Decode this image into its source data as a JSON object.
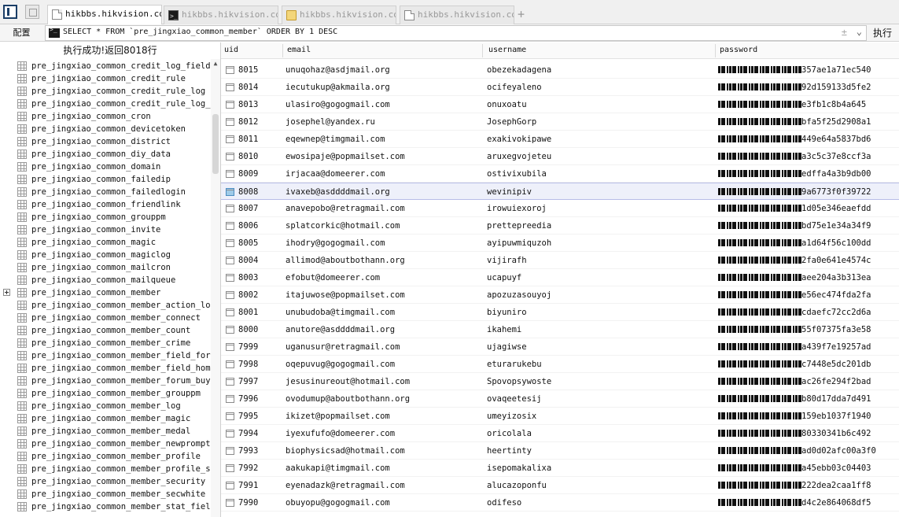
{
  "tabs": [
    {
      "label": "hikbbs.hikvision.com",
      "icon": "document-icon",
      "active": true
    },
    {
      "label": "hikbbs.hikvision.com",
      "icon": "terminal-icon",
      "active": false
    },
    {
      "label": "hikbbs.hikvision.com",
      "icon": "folder-icon",
      "active": false
    },
    {
      "label": "hikbbs.hikvision.com",
      "icon": "document-icon",
      "active": false
    }
  ],
  "toolbar": {
    "config_label": "配置",
    "query": "SELECT * FROM `pre_jingxiao_common_member` ORDER BY 1 DESC",
    "clear_glyph": "±",
    "execute_label": "执行"
  },
  "status": "执行成功!返回8018行",
  "sidebar": {
    "expanded_item": "pre_jingxiao_common_member",
    "tables": [
      "pre_jingxiao_common_credit_log_field",
      "pre_jingxiao_common_credit_rule",
      "pre_jingxiao_common_credit_rule_log",
      "pre_jingxiao_common_credit_rule_log_field",
      "pre_jingxiao_common_cron",
      "pre_jingxiao_common_devicetoken",
      "pre_jingxiao_common_district",
      "pre_jingxiao_common_diy_data",
      "pre_jingxiao_common_domain",
      "pre_jingxiao_common_failedip",
      "pre_jingxiao_common_failedlogin",
      "pre_jingxiao_common_friendlink",
      "pre_jingxiao_common_grouppm",
      "pre_jingxiao_common_invite",
      "pre_jingxiao_common_magic",
      "pre_jingxiao_common_magiclog",
      "pre_jingxiao_common_mailcron",
      "pre_jingxiao_common_mailqueue",
      "pre_jingxiao_common_member",
      "pre_jingxiao_common_member_action_log",
      "pre_jingxiao_common_member_connect",
      "pre_jingxiao_common_member_count",
      "pre_jingxiao_common_member_crime",
      "pre_jingxiao_common_member_field_forum",
      "pre_jingxiao_common_member_field_home",
      "pre_jingxiao_common_member_forum_buylog",
      "pre_jingxiao_common_member_grouppm",
      "pre_jingxiao_common_member_log",
      "pre_jingxiao_common_member_magic",
      "pre_jingxiao_common_member_medal",
      "pre_jingxiao_common_member_newprompt",
      "pre_jingxiao_common_member_profile",
      "pre_jingxiao_common_member_profile_setting",
      "pre_jingxiao_common_member_security",
      "pre_jingxiao_common_member_secwhite",
      "pre_jingxiao_common_member_stat_field"
    ]
  },
  "grid": {
    "columns": [
      "uid",
      "email",
      "username",
      "password"
    ],
    "selected_uid": "8008",
    "rows": [
      {
        "uid": "8015",
        "email": "unuqohaz@asdjmail.org",
        "username": "obezekadagena",
        "password_visible": "357ae1a71ec540"
      },
      {
        "uid": "8014",
        "email": "iecutukup@akmaila.org",
        "username": "ocifeyaleno",
        "password_visible": "92d159133d5fe2"
      },
      {
        "uid": "8013",
        "email": "ulasiro@gogogmail.com",
        "username": "onuxoatu",
        "password_visible": "e3fb1c8b4a645"
      },
      {
        "uid": "8012",
        "email": "josephel@yandex.ru",
        "username": "JosephGorp",
        "password_visible": "bfa5f25d2908a1"
      },
      {
        "uid": "8011",
        "email": "eqewnep@timgmail.com",
        "username": "exakivokipawe",
        "password_visible": "449e64a5837bd6"
      },
      {
        "uid": "8010",
        "email": "ewosipaje@popmailset.com",
        "username": "aruxegvojeteu",
        "password_visible": "a3c5c37e8ccf3a"
      },
      {
        "uid": "8009",
        "email": "irjacaa@domeerer.com",
        "username": "ostivixubila",
        "password_visible": "edffa4a3b9db00"
      },
      {
        "uid": "8008",
        "email": "ivaxeb@asddddmail.org",
        "username": "wevinipiv",
        "password_visible": "9a6773f0f39722"
      },
      {
        "uid": "8007",
        "email": "anavepobo@retragmail.com",
        "username": "irowuiexoroj",
        "password_visible": "1d05e346eaefdd"
      },
      {
        "uid": "8006",
        "email": "splatcorkic@hotmail.com",
        "username": "prettepreedia",
        "password_visible": "bd75e1e34a34f9"
      },
      {
        "uid": "8005",
        "email": "ihodry@gogogmail.com",
        "username": "ayipuwmiquzoh",
        "password_visible": "a1d64f56c100dd"
      },
      {
        "uid": "8004",
        "email": "allimod@aboutbothann.org",
        "username": "vijirafh",
        "password_visible": "2fa0e641e4574c"
      },
      {
        "uid": "8003",
        "email": "efobut@domeerer.com",
        "username": "ucapuyf",
        "password_visible": "aee204a3b313ea"
      },
      {
        "uid": "8002",
        "email": "itajuwose@popmailset.com",
        "username": "apozuzasouyoj",
        "password_visible": "e56ec474fda2fa"
      },
      {
        "uid": "8001",
        "email": "unubudoba@timgmail.com",
        "username": "biyuniro",
        "password_visible": "cdaefc72cc2d6a"
      },
      {
        "uid": "8000",
        "email": "anutore@asddddmail.org",
        "username": "ikahemi",
        "password_visible": "55f07375fa3e58"
      },
      {
        "uid": "7999",
        "email": "uganusur@retragmail.com",
        "username": "ujagiwse",
        "password_visible": "a439f7e19257ad"
      },
      {
        "uid": "7998",
        "email": "oqepuvug@gogogmail.com",
        "username": "eturarukebu",
        "password_visible": "c7448e5dc201db"
      },
      {
        "uid": "7997",
        "email": "jesusinureout@hotmail.com",
        "username": "Spovopsywoste",
        "password_visible": "ac26fe294f2bad"
      },
      {
        "uid": "7996",
        "email": "ovodumup@aboutbothann.org",
        "username": "ovaqeetesij",
        "password_visible": "b80d17dda7d491"
      },
      {
        "uid": "7995",
        "email": "ikizet@popmailset.com",
        "username": "umeyizosix",
        "password_visible": "159eb1037f1940"
      },
      {
        "uid": "7994",
        "email": "iyexufufo@domeerer.com",
        "username": "oricolala",
        "password_visible": "80330341b6c492"
      },
      {
        "uid": "7993",
        "email": "biophysicsad@hotmail.com",
        "username": "heertinty",
        "password_visible": "ad0d02afc00a3f0"
      },
      {
        "uid": "7992",
        "email": "aakukapi@timgmail.com",
        "username": "isepomakalixa",
        "password_visible": "a45ebb03c04403"
      },
      {
        "uid": "7991",
        "email": "eyenadazk@retragmail.com",
        "username": "alucazoponfu",
        "password_visible": "222dea2caa1ff8"
      },
      {
        "uid": "7990",
        "email": "obuyopu@gogogmail.com",
        "username": "odifeso",
        "password_visible": "d4c2e864068df5"
      }
    ]
  }
}
